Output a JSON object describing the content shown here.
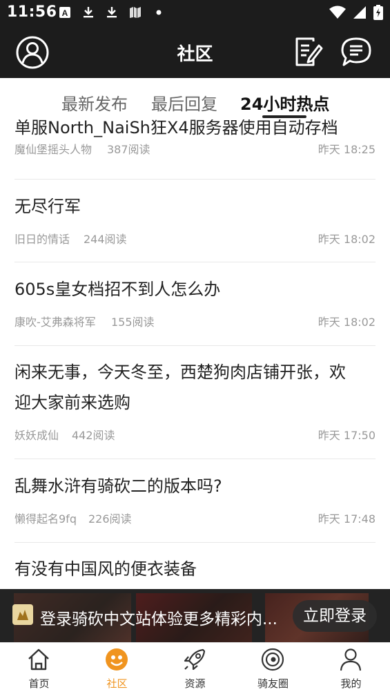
{
  "status_bar": {
    "time": "11:56",
    "notification_icons": [
      "accessibility-a-icon",
      "download-icon",
      "download-icon",
      "book-icon",
      "dot-icon"
    ],
    "system_icons": [
      "wifi-icon",
      "cell-signal-icon",
      "battery-charging-icon"
    ]
  },
  "app_bar": {
    "title": "社区",
    "left_icon": "avatar-icon",
    "right_icons": [
      "edit-note-icon",
      "chat-bubble-icon"
    ]
  },
  "tabs": [
    {
      "label": "最新发布",
      "active": false
    },
    {
      "label": "最后回复",
      "active": false
    },
    {
      "label": "24小时热点",
      "active": true
    }
  ],
  "posts": [
    {
      "title": "单服North_NaiSh狂X4服务器使用自动存档",
      "author": "魔仙堡摇头人物",
      "reads": "387阅读",
      "date": "昨天 18:25"
    },
    {
      "title": "无尽行军",
      "author": "旧日的情话",
      "reads": "244阅读",
      "date": "昨天 18:02"
    },
    {
      "title": "605s皇女档招不到人怎么办",
      "author": "康吹-艾弗森将军",
      "reads": "155阅读",
      "date": "昨天 18:02"
    },
    {
      "title_lines": [
        "闲来无事，今天冬至，西楚狗肉店铺开张，欢",
        "迎大家前来选购"
      ],
      "author": "妖妖成仙",
      "reads": "442阅读",
      "date": "昨天 17:50"
    },
    {
      "title": "乱舞水浒有骑砍二的版本吗?",
      "author": "懒得起名9fq",
      "reads": "226阅读",
      "date": "昨天 17:48"
    },
    {
      "title": "有没有中国风的便衣装备"
    }
  ],
  "login_banner": {
    "text": "登录骑砍中文站体验更多精彩内...",
    "button_label": "立即登录"
  },
  "bottom_nav": [
    {
      "label": "首页",
      "icon": "home-icon",
      "active": false
    },
    {
      "label": "社区",
      "icon": "community-icon",
      "active": true
    },
    {
      "label": "资源",
      "icon": "rocket-icon",
      "active": false
    },
    {
      "label": "骑友圈",
      "icon": "planet-icon",
      "active": false
    },
    {
      "label": "我的",
      "icon": "user-icon",
      "active": false
    }
  ],
  "colors": {
    "dark_bar": "#1c1c1c",
    "accent": "#f0941f",
    "meta_text": "#999999"
  }
}
